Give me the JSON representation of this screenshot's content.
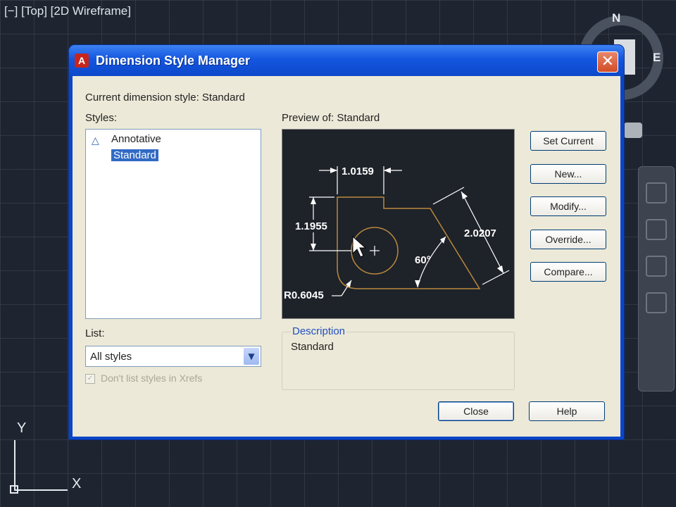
{
  "viewport": {
    "label": "[−] [Top] [2D Wireframe]",
    "compass_n": "N",
    "compass_e": "E",
    "ucs_x": "X",
    "ucs_y": "Y"
  },
  "dialog": {
    "title": "Dimension Style Manager",
    "close_glyph": "✕",
    "current_style": "Current dimension style: Standard",
    "styles_label": "Styles:",
    "styles": [
      {
        "label": "Annotative",
        "icon": "annotative-icon"
      },
      {
        "label": "Standard",
        "selected": true
      }
    ],
    "preview_label": "Preview of: Standard",
    "preview": {
      "dim_top": "1.0159",
      "dim_left": "1.1955",
      "dim_right": "2.0207",
      "angle": "60°",
      "radius": "R0.6045"
    },
    "buttons": {
      "set_current": "Set Current",
      "new": "New...",
      "modify": "Modify...",
      "override": "Override...",
      "compare": "Compare...",
      "close": "Close",
      "help": "Help"
    },
    "list_label": "List:",
    "list_value": "All styles",
    "checkbox_label": "Don't list styles in Xrefs",
    "description_legend": "Description",
    "description_text": "Standard"
  }
}
